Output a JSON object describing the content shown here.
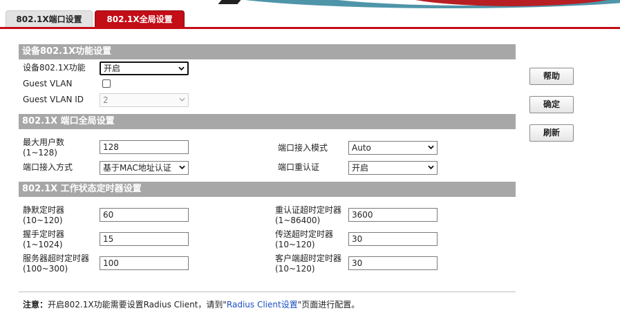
{
  "tabs": [
    "802.1X端口设置",
    "802.1X全局设置"
  ],
  "sections": {
    "device": "设备802.1X功能设置",
    "port_global": "802.1X 端口全局设置",
    "timers": "802.1X 工作状态定时器设置"
  },
  "device": {
    "func_label": "设备802.1X功能",
    "func_value": "开启",
    "guest_vlan_label": "Guest VLAN",
    "guest_vlan_checked": false,
    "guest_vlan_id_label": "Guest VLAN ID",
    "guest_vlan_id_value": "2"
  },
  "port_global": {
    "max_users_label": "最大用户数",
    "max_users_range": "(1~128)",
    "max_users_value": "128",
    "access_mode_label": "端口接入模式",
    "access_mode_value": "Auto",
    "access_method_label": "端口接入方式",
    "access_method_value": "基于MAC地址认证",
    "reauth_label": "端口重认证",
    "reauth_value": "开启"
  },
  "timers": {
    "quiet_label": "静默定时器",
    "quiet_range": "(10~120)",
    "quiet_value": "60",
    "reauth_timeout_label": "重认证超时定时器",
    "reauth_timeout_range": "(1~86400)",
    "reauth_timeout_value": "3600",
    "handshake_label": "握手定时器",
    "handshake_range": "(1~1024)",
    "handshake_value": "15",
    "tx_timeout_label": "传送超时定时器",
    "tx_timeout_range": "(10~120)",
    "tx_timeout_value": "30",
    "server_timeout_label": "服务器超时定时器",
    "server_timeout_range": "(100~300)",
    "server_timeout_value": "100",
    "client_timeout_label": "客户端超时定时器",
    "client_timeout_range": "(10~120)",
    "client_timeout_value": "30"
  },
  "buttons": {
    "help": "帮助",
    "confirm": "确定",
    "refresh": "刷新"
  },
  "note": {
    "prefix": "注意：",
    "text_before": "开启802.1X功能需要设置Radius Client，请到\"",
    "link": "Radius Client设置",
    "text_after": "\"页面进行配置。"
  },
  "colors": {
    "accent": "#c30d17",
    "section_bg": "#a7a7a7",
    "link": "#1a4fc4"
  }
}
